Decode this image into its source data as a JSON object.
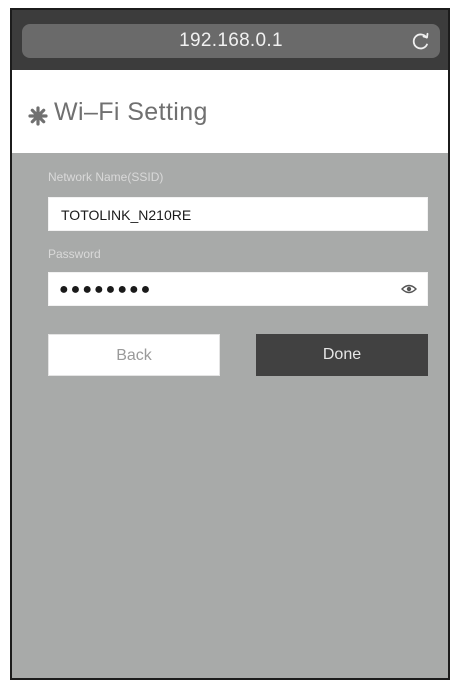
{
  "browser": {
    "url": "192.168.0.1",
    "reload_icon": "reload-icon"
  },
  "header": {
    "icon": "gear-icon",
    "title": "Wi–Fi Setting"
  },
  "form": {
    "ssid_label": "Network Name(SSID)",
    "ssid_value": "TOTOLINK_N210RE",
    "password_label": "Password",
    "password_value": "●●●●●●●●",
    "password_toggle_icon": "eye-icon"
  },
  "buttons": {
    "back_label": "Back",
    "done_label": "Done"
  },
  "colors": {
    "background": "#a8aaa9",
    "topbar": "#3c3c3c",
    "done_button": "#414141"
  }
}
